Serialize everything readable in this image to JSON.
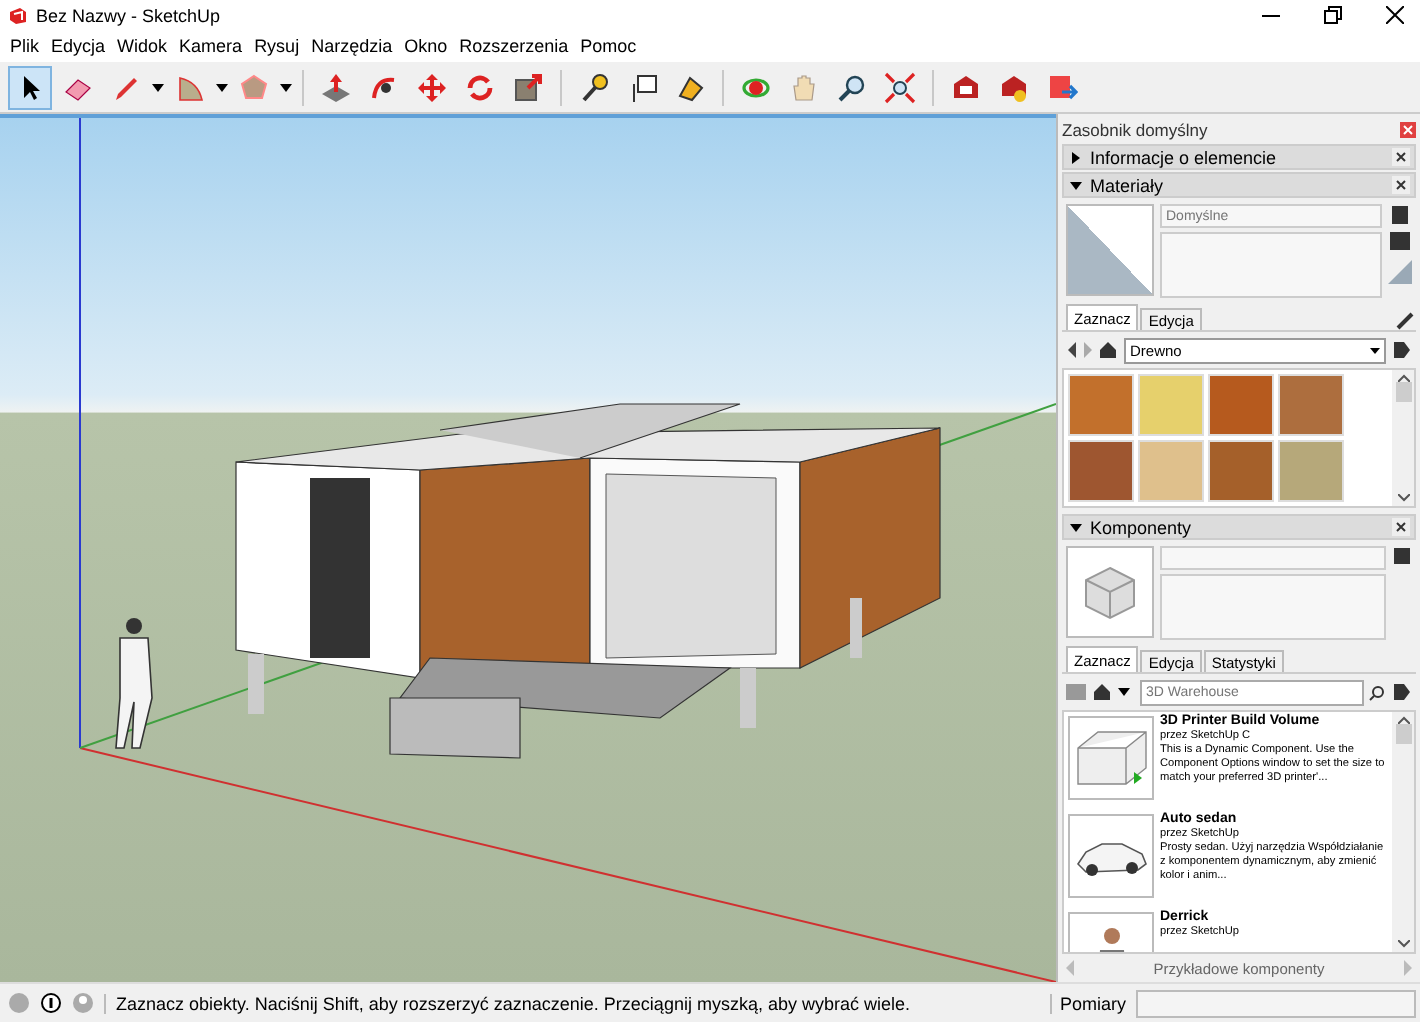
{
  "window": {
    "title": "Bez Nazwy - SketchUp"
  },
  "menu": [
    "Plik",
    "Edycja",
    "Widok",
    "Kamera",
    "Rysuj",
    "Narzędzia",
    "Okno",
    "Rozszerzenia",
    "Pomoc"
  ],
  "toolbar": {
    "tools": [
      {
        "kind": "select",
        "selected": true
      },
      {
        "kind": "eraser",
        "selected": false
      },
      {
        "kind": "pencil",
        "selected": false
      },
      {
        "kind": "arc",
        "selected": false
      },
      {
        "kind": "shape",
        "selected": false
      },
      {
        "kind": "pushpull",
        "selected": false
      },
      {
        "kind": "followme",
        "selected": false
      },
      {
        "kind": "move",
        "selected": false
      },
      {
        "kind": "rotate",
        "selected": false
      },
      {
        "kind": "scale",
        "selected": false
      },
      {
        "kind": "tape",
        "selected": false
      },
      {
        "kind": "text",
        "selected": false
      },
      {
        "kind": "paint",
        "selected": false
      },
      {
        "kind": "orbit",
        "selected": false
      },
      {
        "kind": "pan",
        "selected": false
      },
      {
        "kind": "zoom",
        "selected": false
      },
      {
        "kind": "extents",
        "selected": false
      },
      {
        "kind": "warehouse",
        "selected": false
      },
      {
        "kind": "extension",
        "selected": false
      },
      {
        "kind": "export",
        "selected": false
      }
    ]
  },
  "tray": {
    "title": "Zasobnik domyślny",
    "entity_info": {
      "title": "Informacje o elemencie",
      "expanded": false
    },
    "materials": {
      "title": "Materiały",
      "expanded": true,
      "name_placeholder": "Domyślne",
      "tabs": [
        {
          "label": "Zaznacz",
          "selected": true
        },
        {
          "label": "Edycja",
          "selected": false
        }
      ],
      "library": "Drewno",
      "swatches": [
        {
          "color": "#c2702c"
        },
        {
          "color": "#e6d06c"
        },
        {
          "color": "#b65a1e"
        },
        {
          "color": "#ad6e3e"
        },
        {
          "color": "#9e5630"
        },
        {
          "color": "#dfc08c"
        },
        {
          "color": "#a5602a"
        },
        {
          "color": "#b6a87a"
        }
      ]
    },
    "components": {
      "title": "Komponenty",
      "expanded": true,
      "tabs": [
        {
          "label": "Zaznacz",
          "selected": true
        },
        {
          "label": "Edycja",
          "selected": false
        },
        {
          "label": "Statystyki",
          "selected": false
        }
      ],
      "search_placeholder": "3D Warehouse",
      "items": [
        {
          "kind": "printer",
          "name": "3D Printer Build Volume",
          "author": "przez SketchUp C",
          "description": "This is a Dynamic Component. Use the Component Options window to set the size to match your preferred 3D printer'..."
        },
        {
          "kind": "car",
          "name": "Auto sedan",
          "author": "przez SketchUp",
          "description": "Prosty sedan. Użyj narzędzia Współdziałanie z komponentem dynamicznym, aby zmienić kolor i anim..."
        },
        {
          "kind": "person",
          "name": "Derrick",
          "author": "przez SketchUp"
        }
      ],
      "collection": "Przykładowe komponenty"
    }
  },
  "status_bar": {
    "message": "Zaznacz obiekty. Naciśnij Shift, aby rozszerzyć zaznaczenie. Przeciągnij myszką, aby wybrać wiele.",
    "measure_label": "Pomiary"
  }
}
